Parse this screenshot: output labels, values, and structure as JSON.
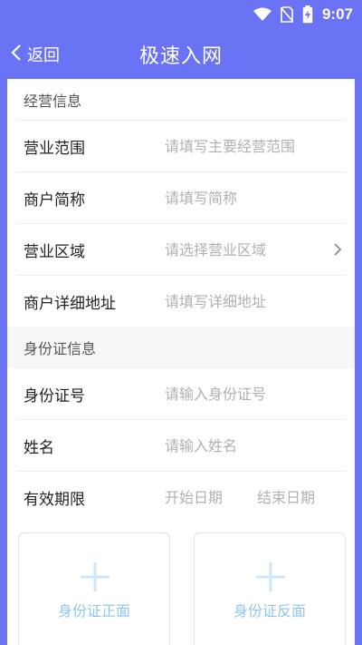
{
  "status_bar": {
    "time": "9:07",
    "icons": [
      "wifi-icon",
      "no-sim-icon",
      "battery-charging-icon"
    ]
  },
  "nav": {
    "back_label": "返回",
    "title": "极速入网",
    "back_icon": "chevron-left-icon"
  },
  "sections": {
    "business": {
      "title": "经营信息",
      "fields": {
        "scope": {
          "label": "营业范围",
          "placeholder": "请填写主要经营范围",
          "value": ""
        },
        "short_name": {
          "label": "商户简称",
          "placeholder": "请填写简称",
          "value": ""
        },
        "region": {
          "label": "营业区域",
          "placeholder": "请选择营业区域",
          "value": "",
          "icon": "chevron-right-icon"
        },
        "address": {
          "label": "商户详细地址",
          "placeholder": "请填写详细地址",
          "value": ""
        }
      }
    },
    "identity": {
      "title": "身份证信息",
      "fields": {
        "id_number": {
          "label": "身份证号",
          "placeholder": "请输入身份证号",
          "value": ""
        },
        "name": {
          "label": "姓名",
          "placeholder": "请输入姓名",
          "value": ""
        },
        "validity": {
          "label": "有效期限",
          "start_placeholder": "开始日期",
          "end_placeholder": "结束日期"
        }
      }
    }
  },
  "uploads": {
    "front": {
      "caption": "身份证正面",
      "icon": "plus-icon"
    },
    "back": {
      "caption": "身份证反面",
      "icon": "plus-icon"
    }
  },
  "colors": {
    "brand": "#6b73f5",
    "upload_accent": "#8fc6f0",
    "placeholder": "#b0b0b0"
  }
}
